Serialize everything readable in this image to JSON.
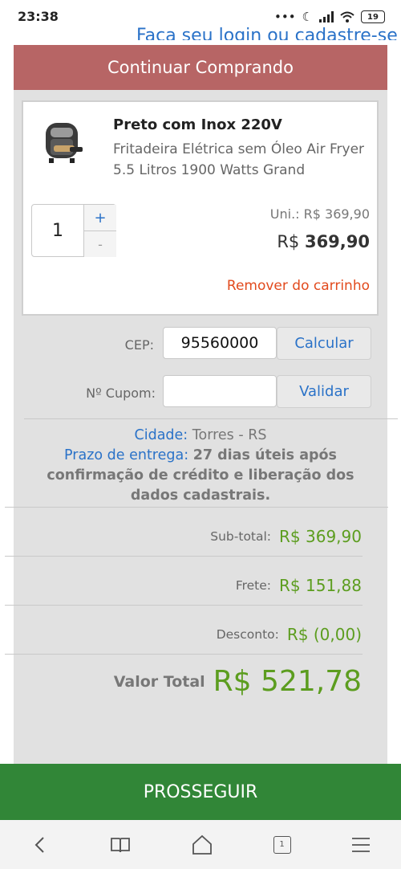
{
  "status": {
    "time": "23:38",
    "battery": "19"
  },
  "header": {
    "login_text": "Faça seu login ou cadastre-se",
    "continue_label": "Continuar Comprando"
  },
  "cart": {
    "variant": "Preto com Inox 220V",
    "name": "Fritadeira Elétrica sem Óleo Air Fryer 5.5 Litros 1900 Watts Grand",
    "quantity": "1",
    "plus": "+",
    "minus": "-",
    "unit_price": "Uni.: R$ 369,90",
    "currency": "R$",
    "line_total": "369,90",
    "remove": "Remover do carrinho"
  },
  "cep": {
    "label": "CEP:",
    "value": "95560000",
    "button": "Calcular"
  },
  "coupon": {
    "label": "Nº Cupom:",
    "value": "",
    "button": "Validar"
  },
  "shipping": {
    "city_label": "Cidade:",
    "city": "Torres - RS",
    "deadline_label": "Prazo de entrega:",
    "deadline": "27 dias úteis após",
    "note": "confirmação de crédito e liberação dos dados cadastrais."
  },
  "summary": {
    "subtotal_label": "Sub-total:",
    "subtotal": "R$ 369,90",
    "freight_label": "Frete:",
    "freight": "R$ 151,88",
    "discount_label": "Desconto:",
    "discount": "R$ (0,00)",
    "total_label": "Valor Total",
    "total": "R$ 521,78"
  },
  "proceed_label": "PROSSEGUIR",
  "nav": {
    "tab_count": "1"
  },
  "colors": {
    "accent": "#2a72c8",
    "continue": "#b76565",
    "proceed": "#318637",
    "price": "#5c9d1f",
    "remove": "#e24a1d"
  }
}
